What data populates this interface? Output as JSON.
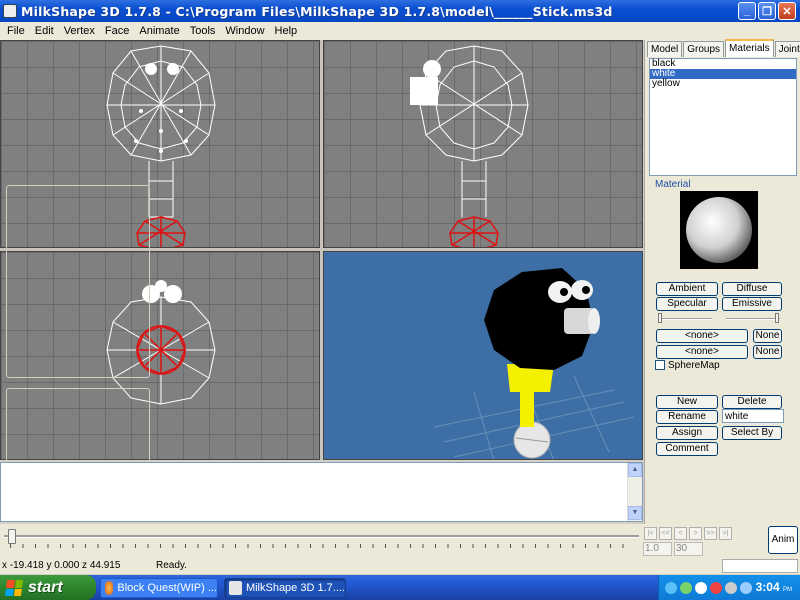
{
  "window": {
    "title": "MilkShape 3D 1.7.8 - C:\\Program Files\\MilkShape 3D 1.7.8\\model\\______Stick.ms3d",
    "min_label": "_",
    "max_label": "❐",
    "close_label": "✕"
  },
  "menu": [
    "File",
    "Edit",
    "Vertex",
    "Face",
    "Animate",
    "Tools",
    "Window",
    "Help"
  ],
  "panel": {
    "tabs": [
      "Model",
      "Groups",
      "Materials",
      "Joints"
    ],
    "active_tab": "Materials",
    "materials": [
      "black",
      "white",
      "yellow"
    ],
    "selected_material": "white",
    "material_group_label": "Material",
    "ambient": "Ambient",
    "diffuse": "Diffuse",
    "specular": "Specular",
    "emissive": "Emissive",
    "texture_none_1": "<none>",
    "texture_none_2": "<none>",
    "none_btn_1": "None",
    "none_btn_2": "None",
    "spheremap": "SphereMap",
    "new": "New",
    "delete": "Delete",
    "rename": "Rename",
    "name_value": "white",
    "assign": "Assign",
    "select_by": "Select By",
    "comment": "Comment"
  },
  "timeline": {
    "nav": [
      "|<",
      "<<",
      "<",
      ">",
      ">>",
      ">|"
    ],
    "start_frame": "1.0",
    "end_frame": "30",
    "anim_label": "Anim"
  },
  "status": {
    "coords": "x -19.418 y 0.000 z 44.915",
    "message": "Ready."
  },
  "taskbar": {
    "start": "start",
    "tasks": [
      "Block Quest(WIP) ...",
      "MilkShape 3D 1.7...."
    ],
    "clock": "3:04",
    "ampm": "PM"
  },
  "colors": {
    "viewport_bg": "#808080",
    "view3d_bg": "#3d6fa6",
    "wire": "#ffffff",
    "selected_wire": "#e01010",
    "yellow_stick": "#f4f000",
    "selection": "#316ac5"
  }
}
